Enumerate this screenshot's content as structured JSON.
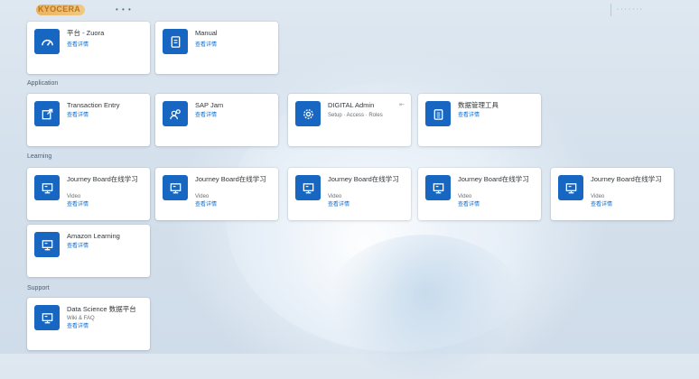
{
  "shell": {
    "logo_text": "KYOCERA",
    "home_label": "• • •",
    "user_area": "· · · · · · ·"
  },
  "groups": {
    "top": {
      "tiles": [
        {
          "title": "平台 - Zuora",
          "link": "查看详情",
          "icon": "dashboard-icon"
        },
        {
          "title": "Manual",
          "link": "查看详情",
          "icon": "document-icon"
        }
      ]
    },
    "application": {
      "title": "Application",
      "tiles": [
        {
          "title": "Transaction Entry",
          "link": "查看详情",
          "icon": "launch-icon"
        },
        {
          "title": "SAP Jam",
          "link": "查看详情",
          "icon": "people-icon"
        },
        {
          "title": "DIGITAL Admin",
          "sub": "Setup · Access · Roles",
          "link": "",
          "icon": "settings-icon",
          "corner": "⇤"
        },
        {
          "title": "数据管理工具",
          "link": "查看详情",
          "icon": "clipboard-icon"
        }
      ]
    },
    "learning": {
      "title": "Learning",
      "tiles": [
        {
          "title": "Journey Board在线学习",
          "sub": "Video",
          "link": "查看详情",
          "icon": "course-icon"
        },
        {
          "title": "Journey Board在线学习",
          "sub": "Video",
          "link": "查看详情",
          "icon": "course-icon"
        },
        {
          "title": "Journey Board在线学习",
          "sub": "Video",
          "link": "查看详情",
          "icon": "course-icon"
        },
        {
          "title": "Journey Board在线学习",
          "sub": "Video",
          "link": "查看详情",
          "icon": "course-icon"
        },
        {
          "title": "Journey Board在线学习",
          "sub": "Video",
          "link": "查看详情",
          "icon": "course-icon"
        },
        {
          "title": "Amazon Learning",
          "link": "查看详情",
          "icon": "course-icon"
        }
      ]
    },
    "support": {
      "title": "Support",
      "tiles": [
        {
          "title": "Data Science 数据平台",
          "sub": "Wiki & FAQ",
          "link": "查看详情",
          "icon": "course-icon"
        }
      ]
    }
  }
}
